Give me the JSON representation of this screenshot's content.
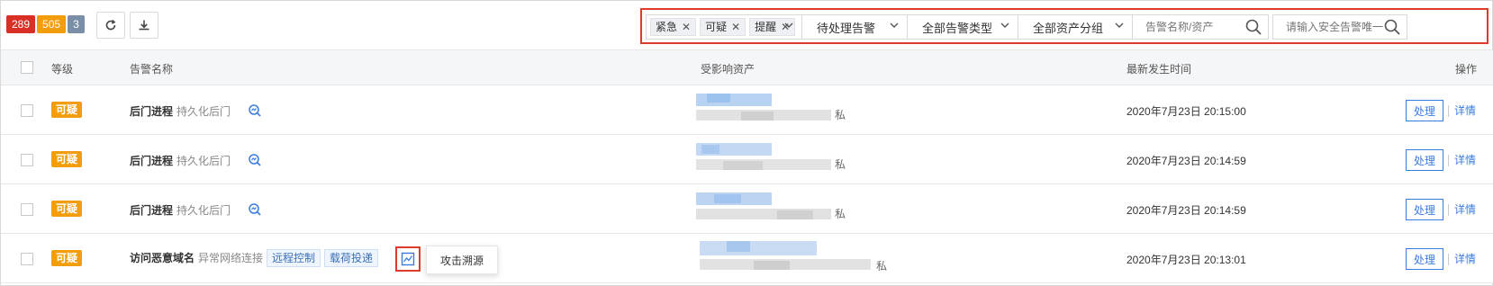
{
  "badges": [
    "289",
    "505",
    "3"
  ],
  "filters": {
    "tags": [
      {
        "label": "紧急"
      },
      {
        "label": "可疑"
      },
      {
        "label": "提醒"
      }
    ],
    "status_select": "待处理告警",
    "type_select": "全部告警类型",
    "group_select": "全部资产分组",
    "name_search_placeholder": "告警名称/资产",
    "id_search_placeholder": "请输入安全告警唯一"
  },
  "table": {
    "headers": {
      "level": "等级",
      "name": "告警名称",
      "asset": "受影响资产",
      "time": "最新发生时间",
      "ops": "操作"
    },
    "rows": [
      {
        "level": "可疑",
        "name": "后门进程",
        "sub": "持久化后门",
        "priv": "私",
        "time": "2020年7月23日 20:15:00",
        "handle": "处理",
        "detail": "详情"
      },
      {
        "level": "可疑",
        "name": "后门进程",
        "sub": "持久化后门",
        "priv": "私",
        "time": "2020年7月23日 20:14:59",
        "handle": "处理",
        "detail": "详情"
      },
      {
        "level": "可疑",
        "name": "后门进程",
        "sub": "持久化后门",
        "priv": "私",
        "time": "2020年7月23日 20:14:59",
        "handle": "处理",
        "detail": "详情"
      },
      {
        "level": "可疑",
        "name": "访问恶意域名",
        "sub": "异常网络连接",
        "chips": [
          "远程控制",
          "载荷投递"
        ],
        "priv": "私",
        "time": "2020年7月23日 20:13:01",
        "handle": "处理",
        "detail": "详情",
        "tooltip": "攻击溯源"
      }
    ]
  },
  "colors": {
    "urgent": "#d93026",
    "suspicious": "#f29d0b",
    "reminder": "#7b8ea8",
    "highlight": "#e03a2a",
    "link": "#3a7be0"
  }
}
